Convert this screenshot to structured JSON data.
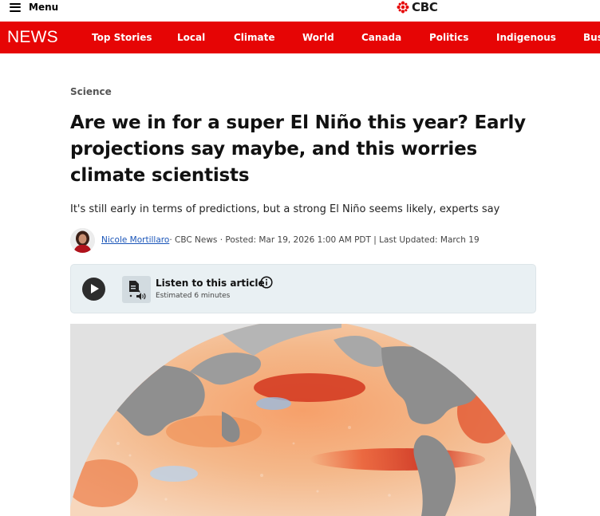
{
  "header": {
    "menu_label": "Menu",
    "logo_text": "CBC",
    "logo_icon": "cbc-gem-icon",
    "brand_color": "#e60505"
  },
  "nav": {
    "brand": "NEWS",
    "items": [
      {
        "label": "Top Stories"
      },
      {
        "label": "Local"
      },
      {
        "label": "Climate"
      },
      {
        "label": "World"
      },
      {
        "label": "Canada"
      },
      {
        "label": "Politics"
      },
      {
        "label": "Indigenous"
      },
      {
        "label": "Bus"
      }
    ]
  },
  "article": {
    "section": "Science",
    "headline": "Are we in for a super El Niño this year? Early projections say maybe, and this worries climate scientists",
    "deck": "It's still early in terms of predictions, but a strong El Niño seems likely, experts say",
    "author": "Nicole Mortillaro",
    "byline_rest": " · CBC News · Posted: Mar 19, 2026 1:00 AM PDT | Last Updated: March 19",
    "link_color": "#1a55b8"
  },
  "listen": {
    "title": "Listen to this article",
    "estimate": "Estimated 6 minutes",
    "play_icon": "play-icon",
    "tts_icon": "text-to-speech-icon",
    "info_icon": "info-icon"
  },
  "hero": {
    "image_icon": "sea-surface-temperature-map"
  }
}
